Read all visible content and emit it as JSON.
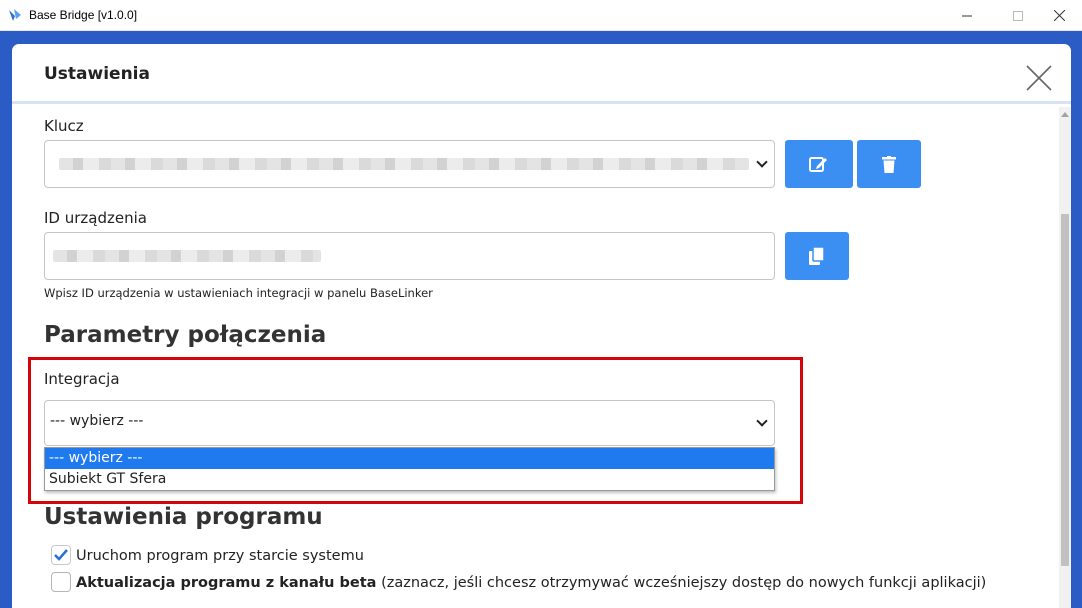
{
  "window": {
    "title": "Base Bridge [v1.0.0]",
    "icon": "base-bridge-app-icon"
  },
  "modal": {
    "title": "Ustawienia"
  },
  "key_section": {
    "label": "Klucz",
    "edit_icon": "edit-icon",
    "delete_icon": "trash-icon"
  },
  "device_section": {
    "label": "ID urządzenia",
    "hint": "Wpisz ID urządzenia w ustawieniach integracji w panelu BaseLinker",
    "copy_icon": "copy-icon"
  },
  "connection": {
    "title": "Parametry połączenia",
    "integration_label": "Integracja",
    "selected_value": "--- wybierz ---",
    "options": [
      "--- wybierz ---",
      "Subiekt GT Sfera"
    ]
  },
  "program_settings": {
    "title": "Ustawienia programu",
    "startup_checkbox": {
      "label": "Uruchom program przy starcie systemu",
      "checked": true
    },
    "beta_checkbox": {
      "label_bold": "Aktualizacja programu z kanału beta",
      "label_rest": " (zaznacz, jeśli chcesz otrzymywać wcześniejszy dostęp do nowych funkcji aplikacji)",
      "checked": false
    }
  },
  "colors": {
    "accent": "#3c8ff2",
    "highlight_border": "#d4040a",
    "background": "#2b5cc6"
  }
}
